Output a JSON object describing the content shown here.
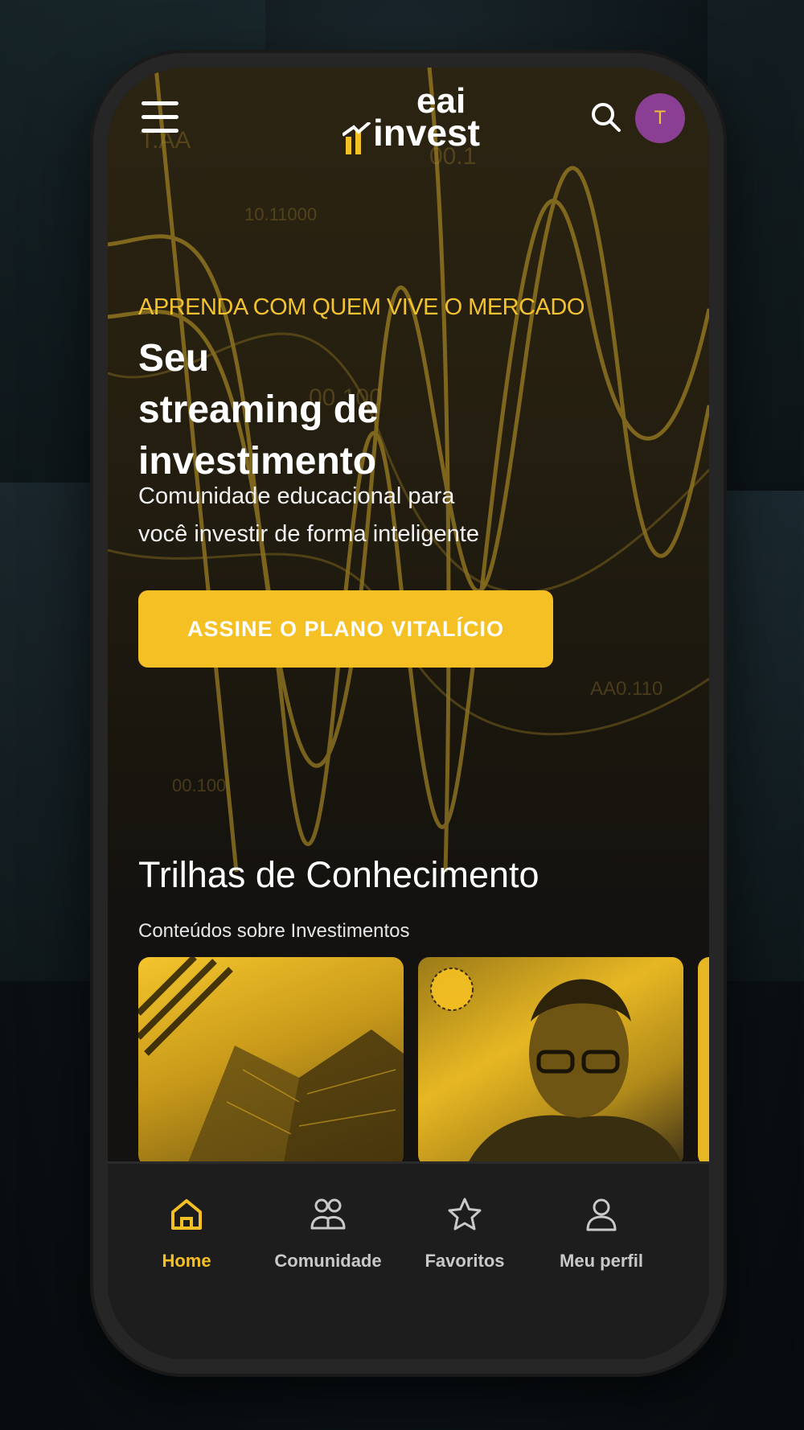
{
  "header": {
    "logo_top": "eai",
    "logo_bottom": "invest",
    "avatar_initial": "T"
  },
  "hero": {
    "eyebrow": "APRENDA COM QUEM VIVE O MERCADO",
    "headline_line1": "Seu",
    "headline_line2": "streaming de",
    "headline_line3": "investimento",
    "subtitle_line1": "Comunidade educacional para",
    "subtitle_line2": "você investir de forma inteligente",
    "cta_label": "ASSINE O PLANO VITALÍCIO"
  },
  "section": {
    "title": "Trilhas de Conhecimento",
    "subtitle": "Conteúdos sobre Investimentos"
  },
  "bottom_nav": {
    "items": [
      {
        "label": "Home",
        "icon": "home-icon",
        "active": true
      },
      {
        "label": "Comunidade",
        "icon": "community-icon",
        "active": false
      },
      {
        "label": "Favoritos",
        "icon": "star-icon",
        "active": false
      },
      {
        "label": "Meu perfil",
        "icon": "user-icon",
        "active": false
      }
    ]
  },
  "colors": {
    "accent": "#f5c024",
    "avatar_bg": "#8a3f95",
    "background": "#141210"
  }
}
